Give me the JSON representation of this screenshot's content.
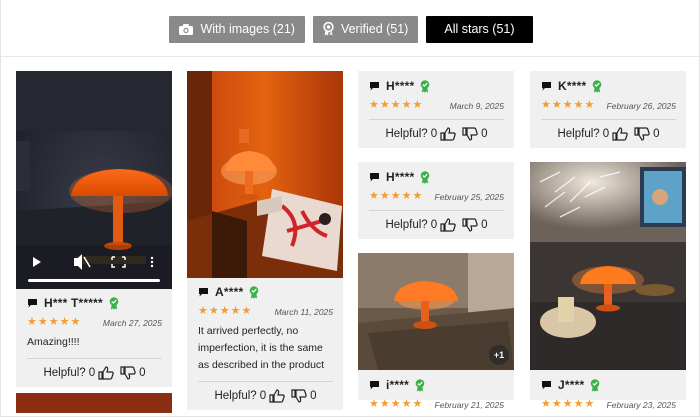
{
  "filters": {
    "with_images": "With images (21)",
    "verified": "Verified (51)",
    "all_stars": "All stars (51)"
  },
  "colors": {
    "star": "#f29d2f",
    "verified_badge": "#3cb14a",
    "active_filter": "#000000",
    "inactive_filter": "#898989",
    "card_bg": "#f0f0f0"
  },
  "helpful_label": "Helpful?",
  "reviews": [
    {
      "name": "H*** T*****",
      "rating": 5,
      "date": "March 27, 2025",
      "text": "Amazing!!!!",
      "helpful_up": "0",
      "helpful_down": "0",
      "media": "video"
    },
    {
      "name": "A****",
      "rating": 5,
      "date": "March 11, 2025",
      "text": "It arrived perfectly, no imperfection, it is the same as described in the product",
      "helpful_up": "0",
      "helpful_down": "0",
      "media": "photo"
    },
    {
      "name": "H****",
      "rating": 5,
      "date": "March 9, 2025",
      "text": "",
      "helpful_up": "0",
      "helpful_down": "0"
    },
    {
      "name": "H****",
      "rating": 5,
      "date": "February 25, 2025",
      "text": "",
      "helpful_up": "0",
      "helpful_down": "0"
    },
    {
      "name": "i****",
      "rating": 5,
      "date": "February 21, 2025",
      "text": "",
      "media": "photo",
      "more_images": "+1"
    },
    {
      "name": "K****",
      "rating": 5,
      "date": "February 26, 2025",
      "text": "",
      "helpful_up": "0",
      "helpful_down": "0"
    },
    {
      "name": "J****",
      "rating": 5,
      "date": "February 23, 2025",
      "text": "",
      "media": "photo"
    }
  ],
  "icons": {
    "camera": "camera-icon",
    "verified": "verified-badge-icon",
    "chat": "chat-bubble-icon",
    "thumb_up": "thumbs-up-icon",
    "thumb_down": "thumbs-down-icon",
    "play": "play-icon",
    "mute": "mute-icon",
    "fullscreen": "fullscreen-icon",
    "more": "more-vertical-icon"
  }
}
